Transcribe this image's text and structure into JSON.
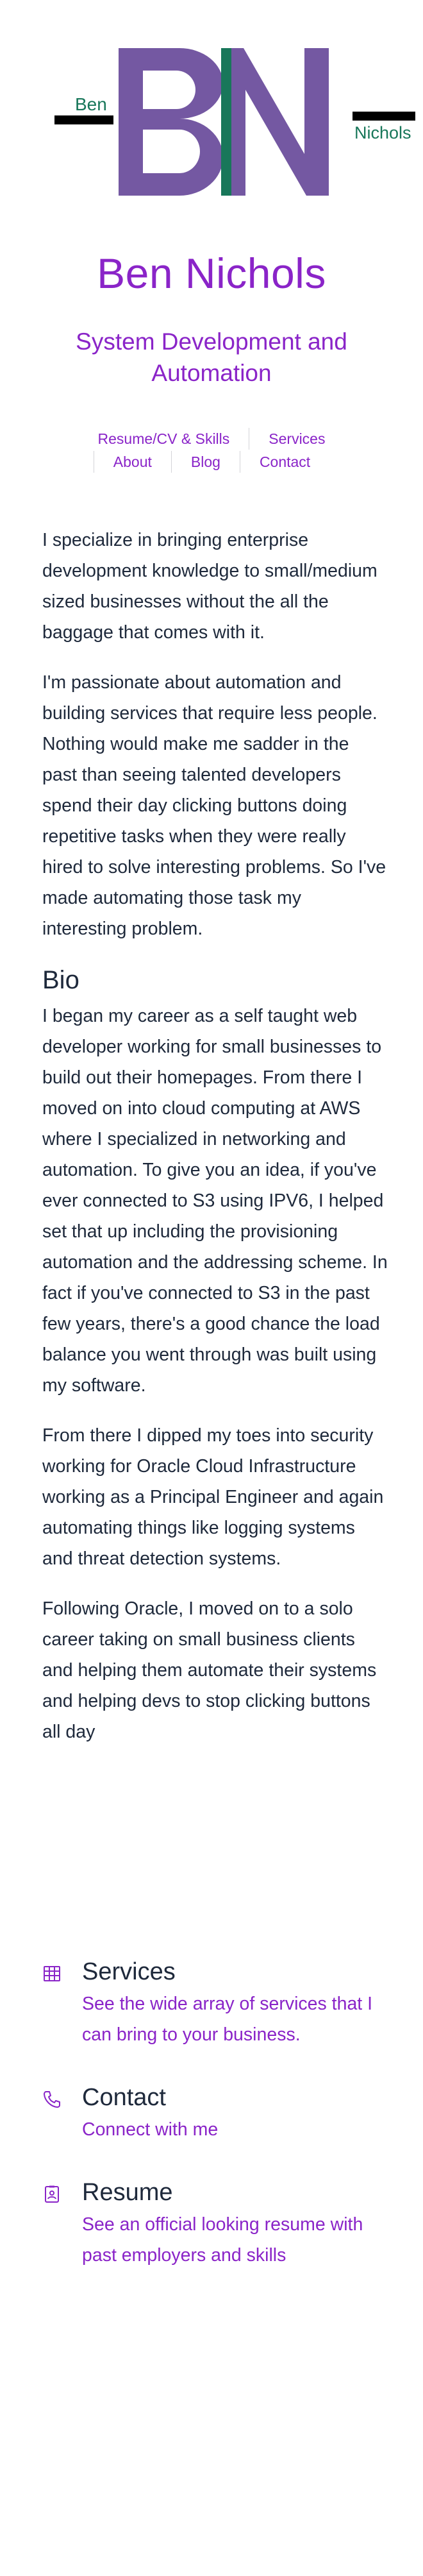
{
  "logo": {
    "first_name": "Ben",
    "last_name": "Nichols",
    "colors": {
      "purple": "#7458a2",
      "green": "#18775a",
      "black": "#000000"
    }
  },
  "header": {
    "title": "Ben Nichols",
    "subtitle": "System Development and Automation"
  },
  "nav": {
    "items": [
      {
        "label": "Resume/CV & Skills"
      },
      {
        "label": "Services"
      },
      {
        "label": "About"
      },
      {
        "label": "Blog"
      },
      {
        "label": "Contact"
      }
    ]
  },
  "main": {
    "intro_1": "I specialize in bringing enterprise development knowledge to small/medium sized businesses without the all the baggage that comes with it.",
    "intro_2": "I'm passionate about automation and building services that require less people. Nothing would make me sadder in the past than seeing talented developers spend their day clicking buttons doing repetitive tasks when they were really hired to solve interesting problems. So I've made automating those task my interesting problem.",
    "bio_heading": "Bio",
    "bio_1": "I began my career as a self taught web developer working for small businesses to build out their homepages. From there I moved on into cloud computing at AWS where I specialized in networking and automation. To give you an idea, if you've ever connected to S3 using IPV6, I helped set that up including the provisioning automation and the addressing scheme. In fact if you've connected to S3 in the past few years, there's a good chance the load balance you went through was built using my software.",
    "bio_2": "From there I dipped my toes into security working for Oracle Cloud Infrastructure working as a Principal Engineer and again automating things like logging systems and threat detection systems.",
    "bio_3": "Following Oracle, I moved on to a solo career taking on small business clients and helping them automate their systems and helping devs to stop clicking buttons all day"
  },
  "cards": [
    {
      "icon": "services-grid-icon",
      "title": "Services",
      "description": "See the wide array of services that I can bring to your business."
    },
    {
      "icon": "phone-icon",
      "title": "Contact",
      "description": "Connect with me"
    },
    {
      "icon": "resume-icon",
      "title": "Resume",
      "description": "See an official looking resume with past employers and skills"
    }
  ],
  "accent_color": "#8a24c8"
}
